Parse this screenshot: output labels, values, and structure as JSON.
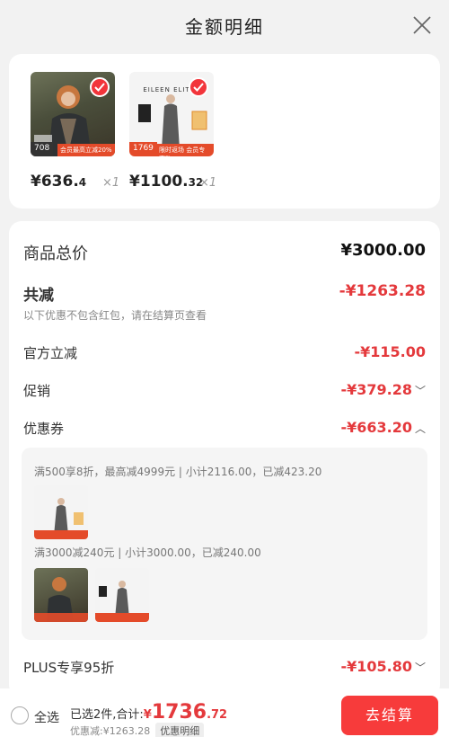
{
  "header": {
    "title": "金额明细",
    "close_icon": "close-icon"
  },
  "products": [
    {
      "brand": "",
      "badge": "708",
      "promo": "会员最高立减20%",
      "price_int": "¥636.",
      "price_dec": "4",
      "qty": "×1"
    },
    {
      "brand": "EILEEN ELITES",
      "badge": "1769",
      "promo": "限时返场 会员专享购",
      "price_int": "¥1100.",
      "price_dec": "32",
      "qty": "×1"
    }
  ],
  "summary": {
    "total_label": "商品总价",
    "total_value": "¥3000.00",
    "discount_label": "共减",
    "discount_value": "-¥1263.28",
    "discount_note": "以下优惠不包含红包，请在结算页查看",
    "official_label": "官方立减",
    "official_value": "-¥115.00",
    "promo_label": "促销",
    "promo_value": "-¥379.28",
    "coupon_label": "优惠券",
    "coupon_value": "-¥663.20",
    "coupon_rule_1": "满500享8折，最高减4999元 | 小计2116.00，已减423.20",
    "coupon_rule_2": "满3000减240元 | 小计3000.00，已减240.00",
    "plus_label": "PLUS专享95折",
    "plus_value": "-¥105.80"
  },
  "bottom": {
    "select_all": "全选",
    "selected_text": "已选2件,合计:",
    "currency": "¥",
    "total_int": "1736",
    "total_dec": ".72",
    "discount_text": "优惠减:¥1263.28",
    "detail_tag": "优惠明细",
    "checkout": "去结算"
  },
  "colors": {
    "accent": "#e4393c",
    "button": "#f73b3b"
  }
}
